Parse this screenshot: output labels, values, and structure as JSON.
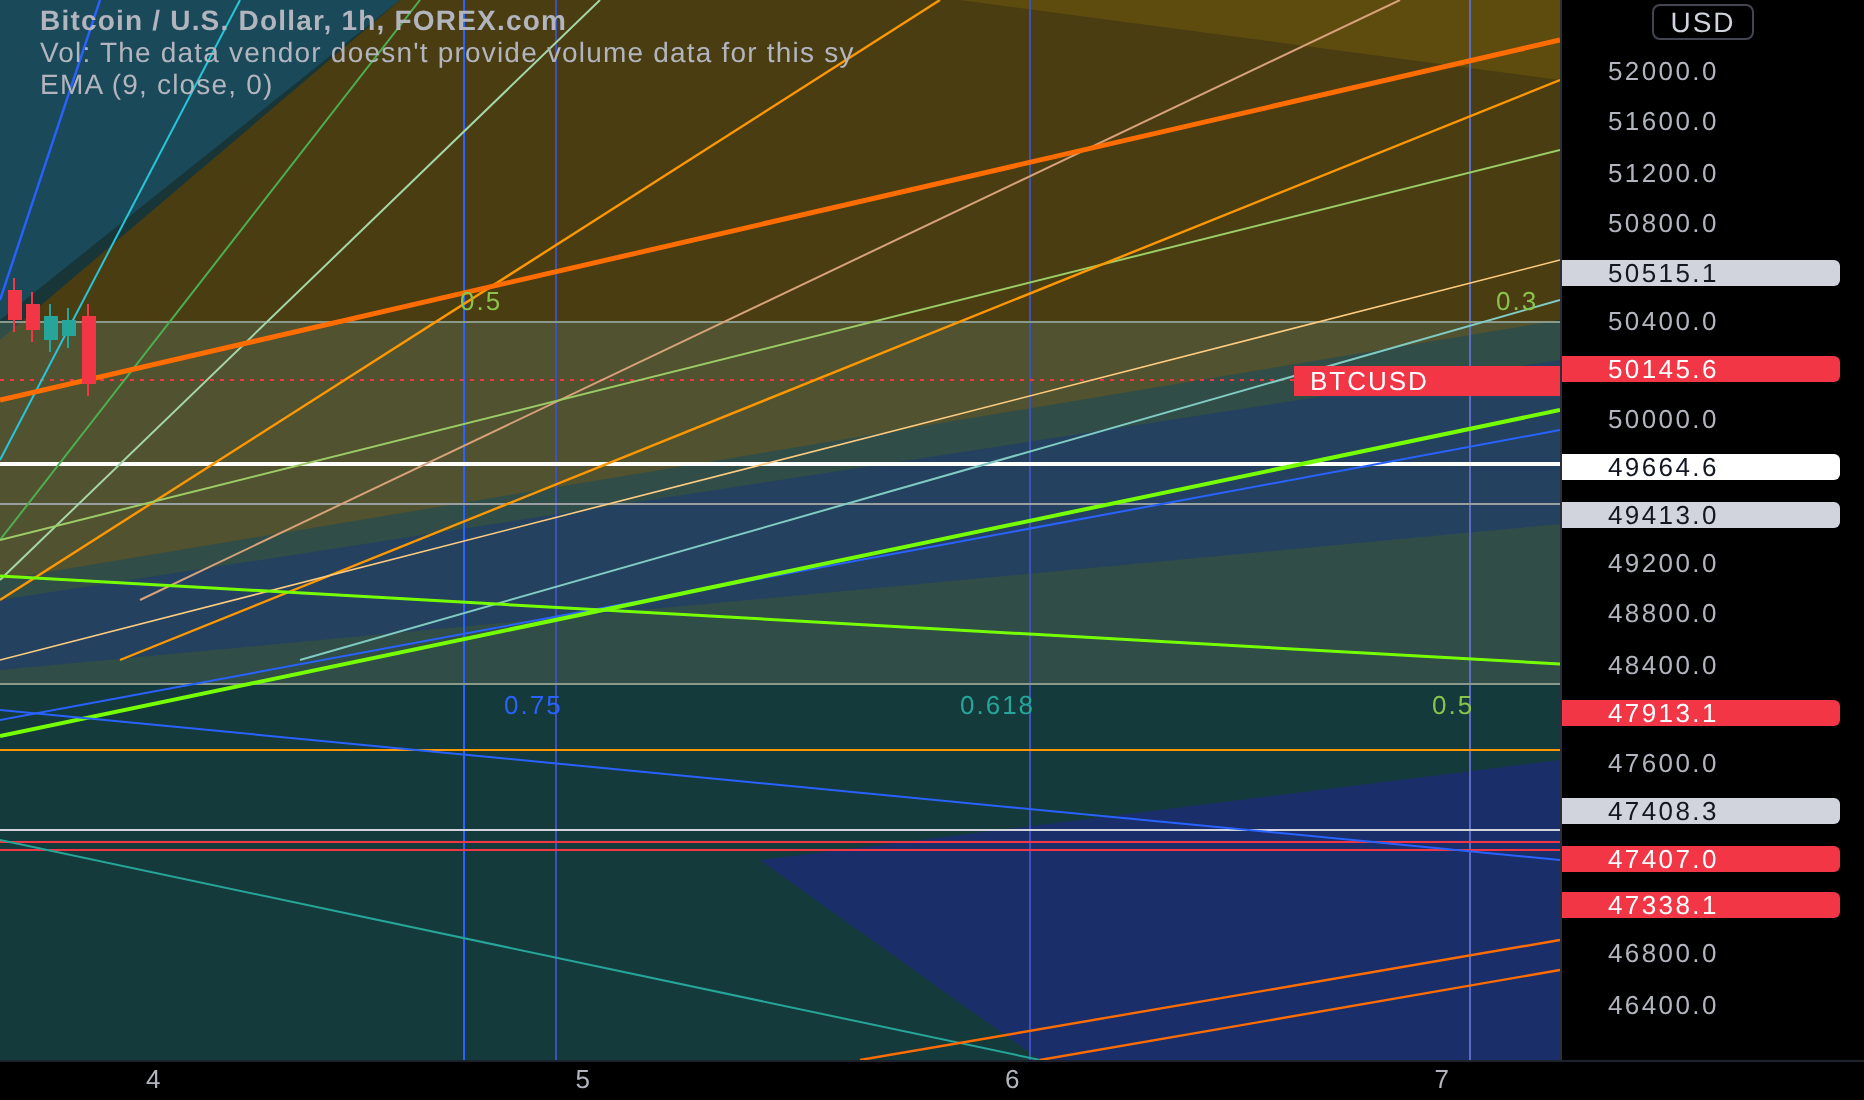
{
  "legend": {
    "title": "Bitcoin / U.S. Dollar, 1h, FOREX.com",
    "lines": [
      "Vol: The data vendor doesn't provide volume data for this sy",
      "EMA (9, close, 0)"
    ]
  },
  "chart": {
    "symbol_tag": {
      "label": "BTCUSD",
      "color": "#f23645"
    },
    "level_labels": [
      {
        "label": "0.5",
        "color": "#8bc34a"
      },
      {
        "label": "0.3",
        "color": "#8bc34a"
      },
      {
        "label": "0.75",
        "color": "#2962ff"
      },
      {
        "label": "0.618",
        "color": "#26a69a"
      },
      {
        "label": "0.5",
        "color": "#8bc34a"
      }
    ]
  },
  "price_axis": {
    "currency_button": "USD",
    "rows": [
      {
        "kind": "tick",
        "label": "52000.0"
      },
      {
        "kind": "tick",
        "label": "51600.0"
      },
      {
        "kind": "tick",
        "label": "51200.0"
      },
      {
        "kind": "tick",
        "label": "50800.0"
      },
      {
        "kind": "badge",
        "label": "50515.1",
        "color": "#d1d4dc"
      },
      {
        "kind": "tick",
        "label": "50400.0"
      },
      {
        "kind": "badge",
        "label": "50145.6",
        "color": "#f23645"
      },
      {
        "kind": "tick",
        "label": "50000.0"
      },
      {
        "kind": "badge",
        "label": "49664.6",
        "color": "#ffffff"
      },
      {
        "kind": "badge",
        "label": "49413.0",
        "color": "#d1d4dc"
      },
      {
        "kind": "tick",
        "label": "49200.0"
      },
      {
        "kind": "tick",
        "label": "48800.0"
      },
      {
        "kind": "tick",
        "label": "48400.0"
      },
      {
        "kind": "badge",
        "label": "47913.1",
        "color": "#f23645"
      },
      {
        "kind": "tick",
        "label": "47600.0"
      },
      {
        "kind": "badge",
        "label": "47408.3",
        "color": "#d1d4dc"
      },
      {
        "kind": "badge",
        "label": "47407.0",
        "color": "#f23645"
      },
      {
        "kind": "badge",
        "label": "47338.1",
        "color": "#f23645"
      },
      {
        "kind": "tick",
        "label": "46800.0"
      },
      {
        "kind": "tick",
        "label": "46400.0"
      }
    ]
  },
  "time_axis": {
    "labels": [
      "4",
      "5",
      "6",
      "7"
    ]
  }
}
